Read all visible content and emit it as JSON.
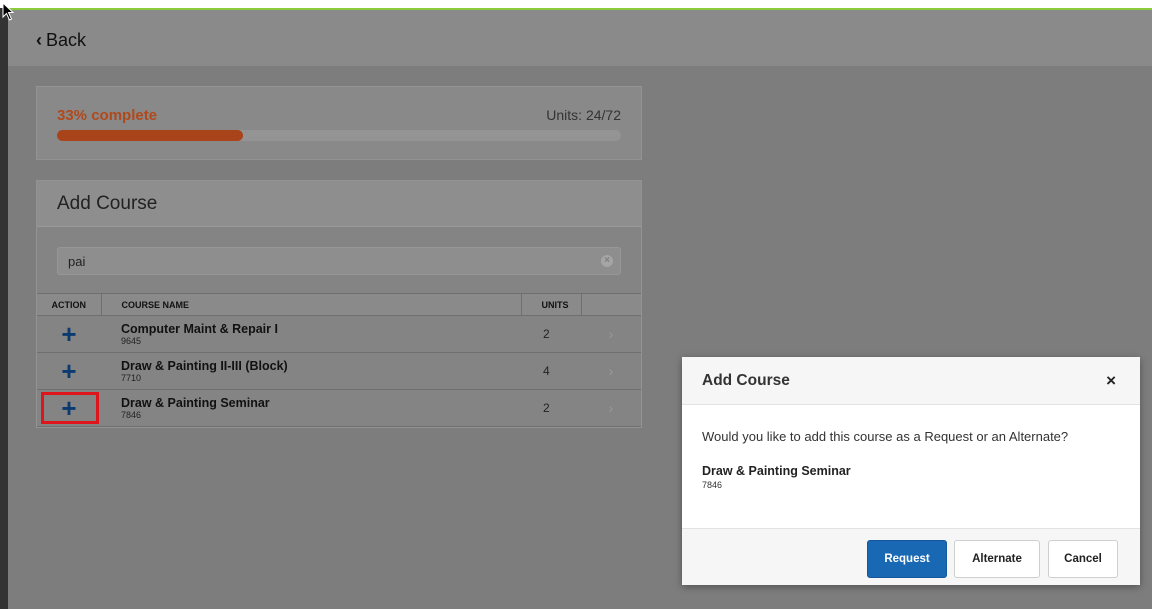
{
  "nav": {
    "back_label": "Back"
  },
  "progress": {
    "percent_label": "33% complete",
    "percent": 33,
    "units_label": "Units: 24/72",
    "bar_color": "#a8431a"
  },
  "add_course": {
    "title": "Add Course",
    "search_value": "pai",
    "columns": {
      "action": "ACTION",
      "course_name": "COURSE NAME",
      "units": "UNITS"
    },
    "rows": [
      {
        "name": "Computer Maint & Repair I",
        "number": "9645",
        "units": "2"
      },
      {
        "name": "Draw & Painting II-III (Block)",
        "number": "7710",
        "units": "4"
      },
      {
        "name": "Draw & Painting Seminar",
        "number": "7846",
        "units": "2"
      }
    ]
  },
  "modal": {
    "title": "Add Course",
    "close_glyph": "×",
    "question": "Would you like to add this course as a Request or an Alternate?",
    "course_name": "Draw & Painting Seminar",
    "course_number": "7846",
    "buttons": {
      "request": "Request",
      "alternate": "Alternate",
      "cancel": "Cancel"
    },
    "primary_color": "#1868b3"
  },
  "icons": {
    "plus": "+",
    "chevron_right": "›",
    "chevron_left": "‹",
    "clear": "×"
  }
}
